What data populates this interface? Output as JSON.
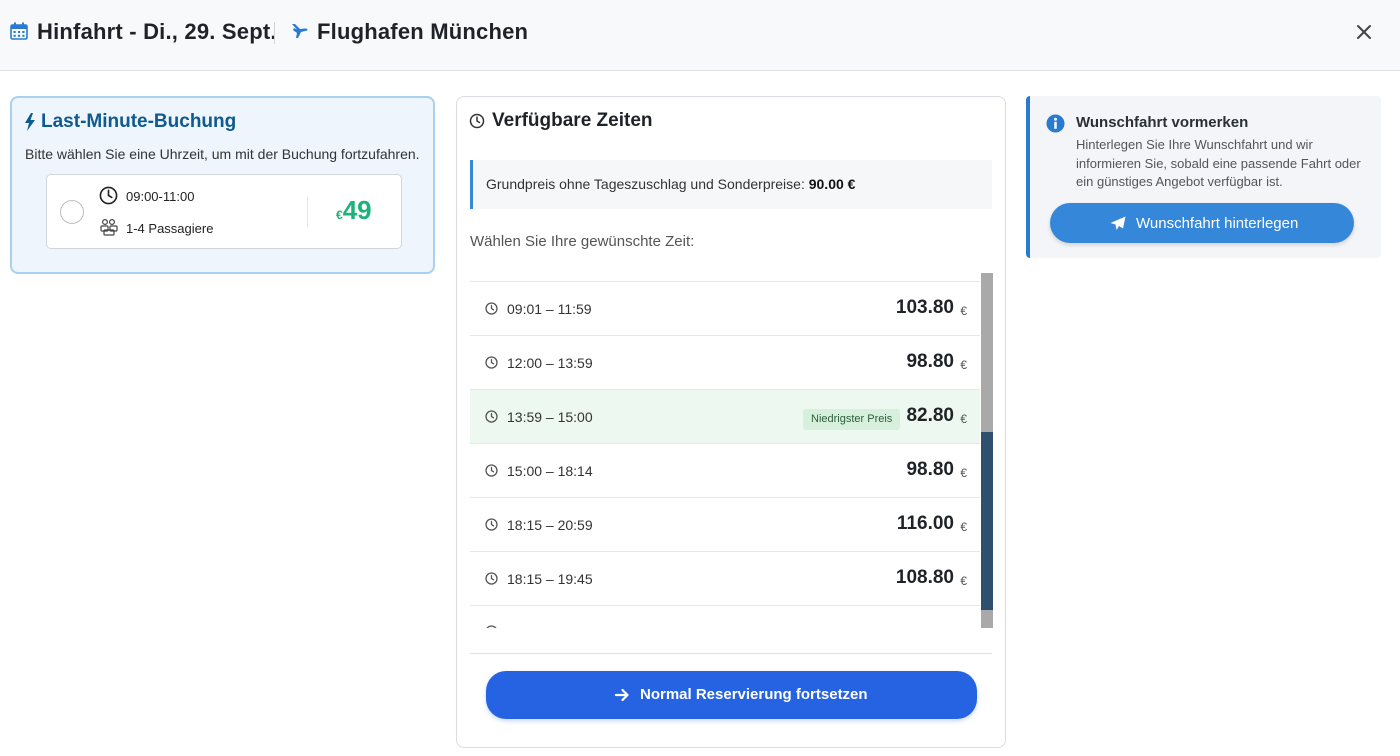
{
  "header": {
    "title": "Hinfahrt - Di., 29. Sept.",
    "destination": "Flughafen München",
    "icons": {
      "calendar": "calendar-icon",
      "plane": "plane-icon",
      "close": "close-icon"
    }
  },
  "last_minute": {
    "title": "Last-Minute-Buchung",
    "subtitle": "Bitte wählen Sie eine Uhrzeit, um mit der Buchung fortzufahren.",
    "option": {
      "time": "09:00-11:00",
      "passengers": "1-4 Passagiere",
      "currency": "€",
      "price": "49",
      "selected": false
    },
    "accent_color": "#0f5a8e",
    "price_color": "#1db27a"
  },
  "times": {
    "title": "Verfügbare Zeiten",
    "base_price_label": "Grundpreis ohne Tageszuschlag und Sonderpreise:",
    "base_price_value": "90.00 €",
    "choose_label": "Wählen Sie Ihre gewünschte Zeit:",
    "rows": [
      {
        "time": "09:01 – 11:59",
        "price": "103.80",
        "currency": "€",
        "badge": ""
      },
      {
        "time": "12:00 – 13:59",
        "price": "98.80",
        "currency": "€",
        "badge": ""
      },
      {
        "time": "13:59 – 15:00",
        "price": "82.80",
        "currency": "€",
        "badge": "Niedrigster Preis"
      },
      {
        "time": "15:00 – 18:14",
        "price": "98.80",
        "currency": "€",
        "badge": ""
      },
      {
        "time": "18:15 – 20:59",
        "price": "116.00",
        "currency": "€",
        "badge": ""
      },
      {
        "time": "18:15 – 19:45",
        "price": "108.80",
        "currency": "€",
        "badge": ""
      }
    ],
    "continue_button": "Normal Reservierung fortsetzen",
    "button_color": "#2563e3"
  },
  "wish": {
    "title": "Wunschfahrt vormerken",
    "description": "Hinterlegen Sie Ihre Wunschfahrt und wir informieren Sie, sobald eine passende Fahrt oder ein günstiges Angebot verfügbar ist.",
    "button": "Wunschfahrt hinterlegen",
    "button_color": "#3487d9"
  }
}
